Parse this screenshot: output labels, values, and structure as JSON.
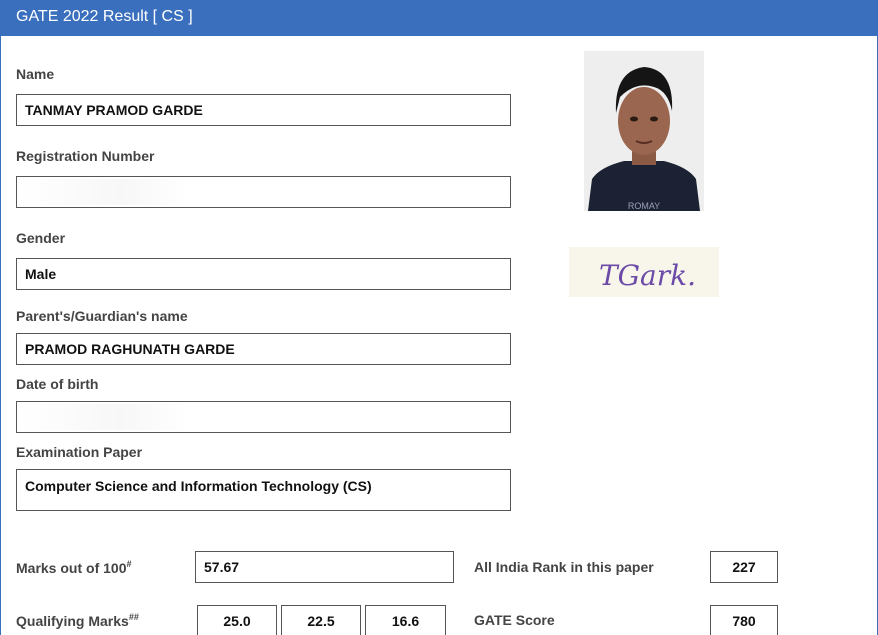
{
  "header": {
    "title": "GATE 2022 Result [ CS ]"
  },
  "form": {
    "name": {
      "label": "Name",
      "value": "TANMAY PRAMOD GARDE"
    },
    "registration": {
      "label": "Registration Number",
      "value": ""
    },
    "gender": {
      "label": "Gender",
      "value": "Male"
    },
    "guardian": {
      "label": "Parent's/Guardian's name",
      "value": "PRAMOD RAGHUNATH GARDE"
    },
    "dob": {
      "label": "Date of birth",
      "value": ""
    },
    "paper": {
      "label": "Examination Paper",
      "value": "Computer Science and Information Technology (CS)"
    }
  },
  "scores": {
    "marks_label": "Marks out of 100",
    "marks_sup": "#",
    "marks_value": "57.67",
    "rank_label": "All India Rank in this paper",
    "rank_value": "227",
    "qualifying_label": "Qualifying Marks",
    "qualifying_sup": "##",
    "qualifying_values": [
      "25.0",
      "22.5",
      "16.6"
    ],
    "gate_score_label": "GATE Score",
    "gate_score_value": "780"
  },
  "images": {
    "photo_shirt_text": "ROMAY",
    "signature_text": "TGark."
  },
  "colors": {
    "header_bg": "#3a6fbd",
    "signature_ink": "#6b4aa8"
  }
}
